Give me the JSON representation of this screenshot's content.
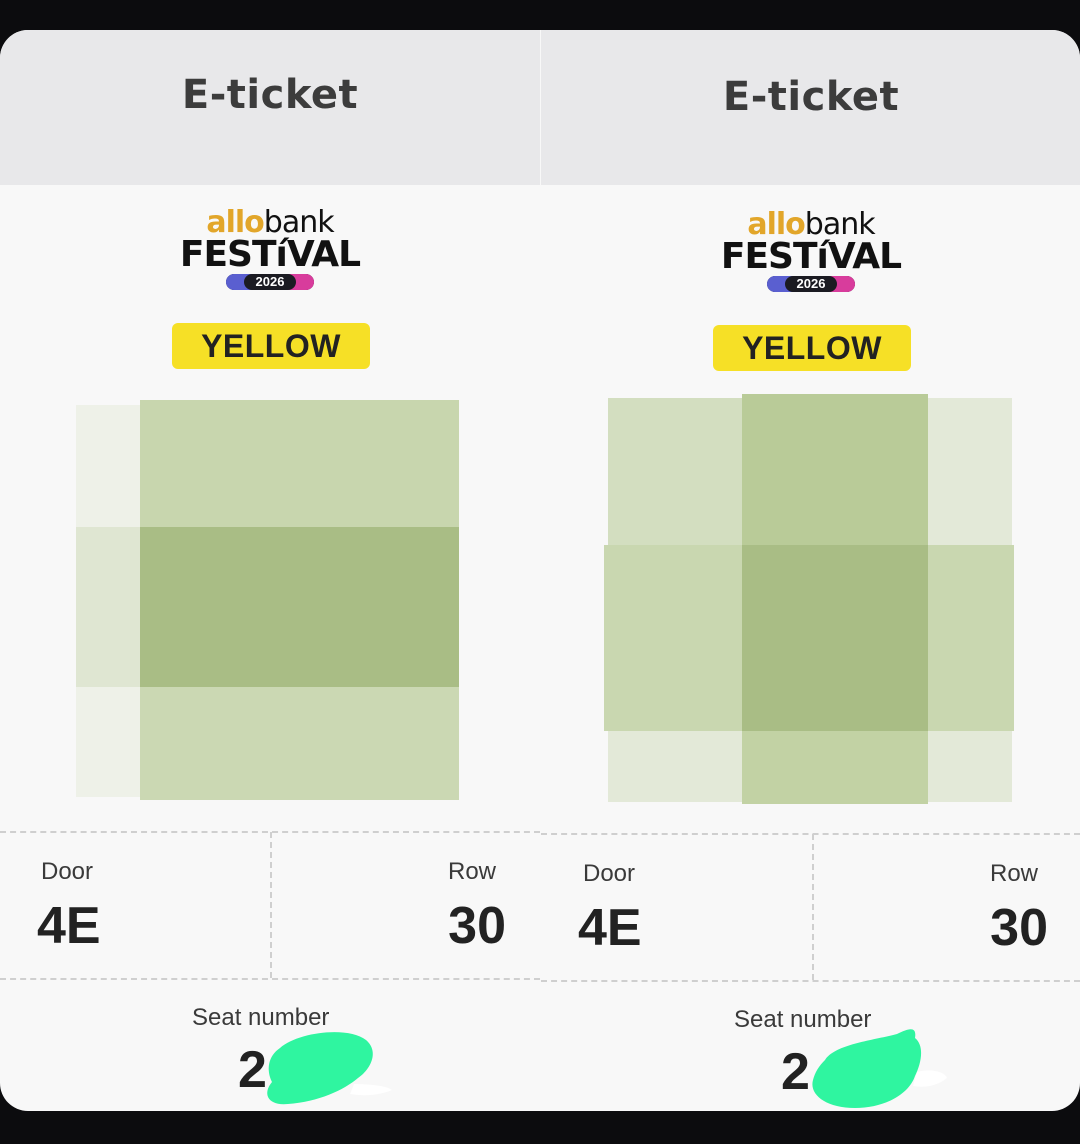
{
  "tickets": [
    {
      "title": "E-ticket",
      "logo": {
        "brand_allo": "allo",
        "brand_bank": "bank",
        "festival": "FESTíVAL",
        "year": "2026"
      },
      "tier": "YELLOW",
      "door_label": "Door",
      "door_value": "4E",
      "row_label": "Row",
      "row_value": "30",
      "seat_label": "Seat number",
      "seat_value": "2"
    },
    {
      "title": "E-ticket",
      "logo": {
        "brand_allo": "allo",
        "brand_bank": "bank",
        "festival": "FESTíVAL",
        "year": "2026"
      },
      "tier": "YELLOW",
      "door_label": "Door",
      "door_value": "4E",
      "row_label": "Row",
      "row_value": "30",
      "seat_label": "Seat number",
      "seat_value": "2"
    }
  ],
  "colors": {
    "tier_badge": "#f6e026",
    "header_bg": "#e8e8ea",
    "qr_blur": "#a9bd85",
    "redaction": "#2ff5a0",
    "brand_allo": "#e2a62a"
  }
}
